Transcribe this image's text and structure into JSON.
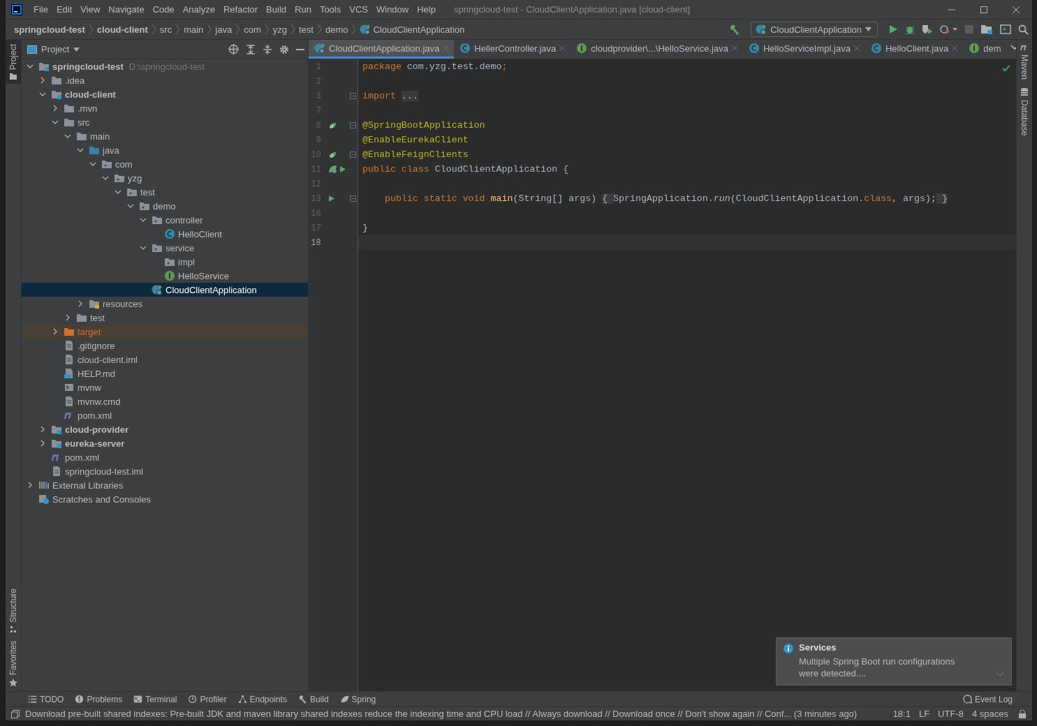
{
  "window": {
    "title": "springcloud-test - CloudClientApplication.java [cloud-client]"
  },
  "menu": [
    "File",
    "Edit",
    "View",
    "Navigate",
    "Code",
    "Analyze",
    "Refactor",
    "Build",
    "Run",
    "Tools",
    "VCS",
    "Window",
    "Help"
  ],
  "breadcrumbs": [
    {
      "label": "springcloud-test",
      "bold": true
    },
    {
      "label": "cloud-client",
      "bold": true
    },
    {
      "label": "src",
      "bold": false
    },
    {
      "label": "main",
      "bold": false
    },
    {
      "label": "java",
      "bold": false
    },
    {
      "label": "com",
      "bold": false
    },
    {
      "label": "yzg",
      "bold": false
    },
    {
      "label": "test",
      "bold": false
    },
    {
      "label": "demo",
      "bold": false
    },
    {
      "label": "CloudClientApplication",
      "bold": false,
      "kind": "app"
    }
  ],
  "run_config": "CloudClientApplication",
  "left_stripe": [
    "Project",
    "Structure",
    "Favorites"
  ],
  "right_stripe": [
    "Maven",
    "Database"
  ],
  "project_panel": {
    "title": "Project",
    "tree": [
      {
        "label": "springcloud-test",
        "hint": "D:\\springcloud-test",
        "kind": "module",
        "bold": true,
        "expanded": true,
        "selected": false,
        "children": [
          {
            "label": ".idea",
            "kind": "folder",
            "expanded": false,
            "selected": false
          },
          {
            "label": "cloud-client",
            "kind": "module",
            "bold": true,
            "expanded": true,
            "selected": false,
            "children": [
              {
                "label": ".mvn",
                "kind": "folder",
                "expanded": false,
                "selected": false
              },
              {
                "label": "src",
                "kind": "folder",
                "expanded": true,
                "selected": false,
                "children": [
                  {
                    "label": "main",
                    "kind": "folder",
                    "expanded": true,
                    "selected": false,
                    "children": [
                      {
                        "label": "java",
                        "kind": "source",
                        "expanded": true,
                        "selected": false,
                        "children": [
                          {
                            "label": "com",
                            "kind": "package",
                            "expanded": true,
                            "selected": false,
                            "children": [
                              {
                                "label": "yzg",
                                "kind": "package",
                                "expanded": true,
                                "selected": false,
                                "children": [
                                  {
                                    "label": "test",
                                    "kind": "package",
                                    "expanded": true,
                                    "selected": false,
                                    "children": [
                                      {
                                        "label": "demo",
                                        "kind": "package",
                                        "expanded": true,
                                        "selected": false,
                                        "children": [
                                          {
                                            "label": "controller",
                                            "kind": "package",
                                            "expanded": true,
                                            "selected": false,
                                            "children": [
                                              {
                                                "label": "HelloClient",
                                                "kind": "class",
                                                "selected": false
                                              }
                                            ]
                                          },
                                          {
                                            "label": "service",
                                            "kind": "package",
                                            "expanded": true,
                                            "selected": false,
                                            "children": [
                                              {
                                                "label": "impl",
                                                "kind": "package",
                                                "selected": false
                                              },
                                              {
                                                "label": "HelloService",
                                                "kind": "interface",
                                                "selected": false
                                              }
                                            ]
                                          },
                                          {
                                            "label": "CloudClientApplication",
                                            "kind": "app",
                                            "selected": true
                                          }
                                        ]
                                      }
                                    ]
                                  }
                                ]
                              }
                            ]
                          }
                        ]
                      },
                      {
                        "label": "resources",
                        "kind": "resources",
                        "expanded": false,
                        "selected": false
                      }
                    ]
                  },
                  {
                    "label": "test",
                    "kind": "folder",
                    "expanded": false,
                    "selected": false
                  }
                ]
              },
              {
                "label": "target",
                "kind": "excluded",
                "expanded": false,
                "selected": false
              },
              {
                "label": ".gitignore",
                "kind": "file",
                "selected": false
              },
              {
                "label": "cloud-client.iml",
                "kind": "iml",
                "selected": false
              },
              {
                "label": "HELP.md",
                "kind": "md",
                "selected": false
              },
              {
                "label": "mvnw",
                "kind": "script",
                "selected": false
              },
              {
                "label": "mvnw.cmd",
                "kind": "file",
                "selected": false
              },
              {
                "label": "pom.xml",
                "kind": "maven",
                "selected": false
              }
            ]
          },
          {
            "label": "cloud-provider",
            "kind": "module",
            "bold": true,
            "expanded": false,
            "selected": false
          },
          {
            "label": "eureka-server",
            "kind": "module",
            "bold": true,
            "expanded": false,
            "selected": false
          },
          {
            "label": "pom.xml",
            "kind": "maven",
            "selected": false
          },
          {
            "label": "springcloud-test.iml",
            "kind": "iml",
            "selected": false
          }
        ]
      },
      {
        "label": "External Libraries",
        "kind": "libs",
        "expanded": false,
        "selected": false
      },
      {
        "label": "Scratches and Consoles",
        "kind": "scratch",
        "selected": false
      }
    ]
  },
  "tabs": [
    {
      "label": "CloudClientApplication.java",
      "kind": "app",
      "selected": true
    },
    {
      "label": "HellerController.java",
      "kind": "class",
      "selected": false
    },
    {
      "label": "cloudprovider\\...\\HelloService.java",
      "kind": "interface",
      "selected": false
    },
    {
      "label": "HelloServiceImpl.java",
      "kind": "class",
      "selected": false
    },
    {
      "label": "HelloClient.java",
      "kind": "class",
      "selected": false
    },
    {
      "label": "dem",
      "kind": "interface",
      "selected": false
    }
  ],
  "code": [
    {
      "n": "1",
      "tokens": [
        {
          "t": "package ",
          "kind": "kw"
        },
        {
          "t": "com.yzg.test.demo",
          "kind": "id"
        },
        {
          "t": ";",
          "kind": "kw"
        }
      ]
    },
    {
      "n": "2"
    },
    {
      "n": "3",
      "fold": true,
      "tokens": [
        {
          "t": "import ",
          "kind": "kw"
        },
        {
          "t": "...",
          "kind": "folded"
        }
      ]
    },
    {
      "n": "7"
    },
    {
      "n": "8",
      "markers": [
        {
          "kind": "bean"
        }
      ],
      "fold": true,
      "tokens": [
        {
          "t": "@SpringBootApplication",
          "kind": "ann"
        }
      ]
    },
    {
      "n": "9",
      "tokens": [
        {
          "t": "@EnableEurekaClient",
          "kind": "ann"
        }
      ]
    },
    {
      "n": "10",
      "markers": [
        {
          "kind": "bean"
        }
      ],
      "fold": true,
      "tokens": [
        {
          "t": "@EnableFeignClients",
          "kind": "ann"
        }
      ]
    },
    {
      "n": "11",
      "markers": [
        {
          "kind": "app"
        },
        {
          "kind": "run"
        }
      ],
      "tokens": [
        {
          "t": "public class ",
          "kind": "kw"
        },
        {
          "t": "CloudClientApplication {",
          "kind": "id"
        }
      ]
    },
    {
      "n": "12"
    },
    {
      "n": "13",
      "markers": [
        {
          "kind": "run"
        }
      ],
      "fold": true,
      "tokens": [
        {
          "t": "    public static void ",
          "kind": "kw"
        },
        {
          "t": "main",
          "kind": "fn"
        },
        {
          "t": "(String[] args) ",
          "kind": "id"
        },
        {
          "t": "{ ",
          "kind": "folded"
        },
        {
          "t": "SpringApplication.",
          "kind": "id"
        },
        {
          "t": "run",
          "kind": "it"
        },
        {
          "t": "(CloudClientApplication.",
          "kind": "id"
        },
        {
          "t": "class",
          "kind": "kw"
        },
        {
          "t": ", args);",
          "kind": "id"
        },
        {
          "t": " }",
          "kind": "folded"
        }
      ]
    },
    {
      "n": "16"
    },
    {
      "n": "17",
      "tokens": [
        {
          "t": "}",
          "kind": "id"
        }
      ]
    },
    {
      "n": "18",
      "current": true
    }
  ],
  "notification": {
    "title": "Services",
    "body": "Multiple Spring Boot run configurations were detected...."
  },
  "bottom_tools": [
    {
      "label": "TODO",
      "kind": "todo"
    },
    {
      "label": "Problems",
      "kind": "problems"
    },
    {
      "label": "Terminal",
      "kind": "terminal"
    },
    {
      "label": "Profiler",
      "kind": "profiler"
    },
    {
      "label": "Endpoints",
      "kind": "endpoints"
    },
    {
      "label": "Build",
      "kind": "build"
    },
    {
      "label": "Spring",
      "kind": "spring"
    }
  ],
  "event_log": "Event Log",
  "status_bar": {
    "message": "Download pre-built shared indexes: Pre-built JDK and maven library shared indexes reduce the indexing time and CPU load // Always download // Download once // Don't show again // Conf... (3 minutes ago)",
    "position": "18:1",
    "line_separator": "LF",
    "encoding": "UTF-8",
    "indent": "4 spaces"
  }
}
